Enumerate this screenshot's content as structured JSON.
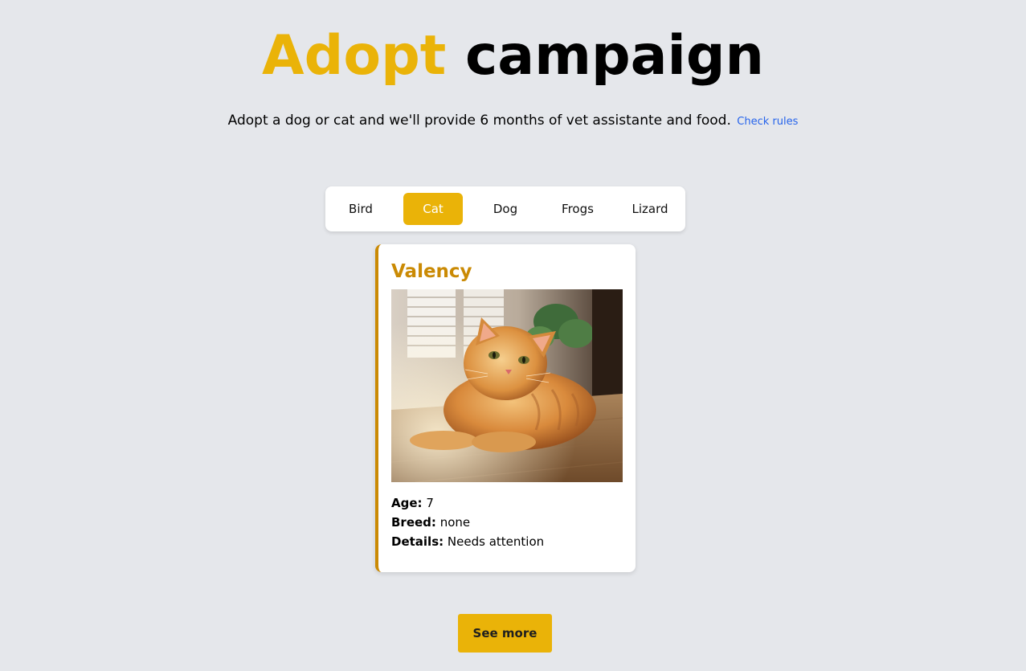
{
  "header": {
    "title_accent": "Adopt",
    "title_rest": "campaign",
    "subtitle": "Adopt a dog or cat and we'll provide 6 months of vet assistante and food.",
    "rules_link": "Check rules"
  },
  "tabs": [
    {
      "label": "Bird",
      "active": false
    },
    {
      "label": "Cat",
      "active": true
    },
    {
      "label": "Dog",
      "active": false
    },
    {
      "label": "Frogs",
      "active": false
    },
    {
      "label": "Lizard",
      "active": false
    }
  ],
  "pet": {
    "name": "Valency",
    "age_label": "Age:",
    "age": "7",
    "breed_label": "Breed:",
    "breed": "none",
    "details_label": "Details:",
    "details": "Needs attention"
  },
  "actions": {
    "see_more": "See more"
  },
  "colors": {
    "accent": "#eab308",
    "accent_dark": "#ca8a04",
    "background": "#e5e7eb",
    "link": "#2563eb"
  }
}
